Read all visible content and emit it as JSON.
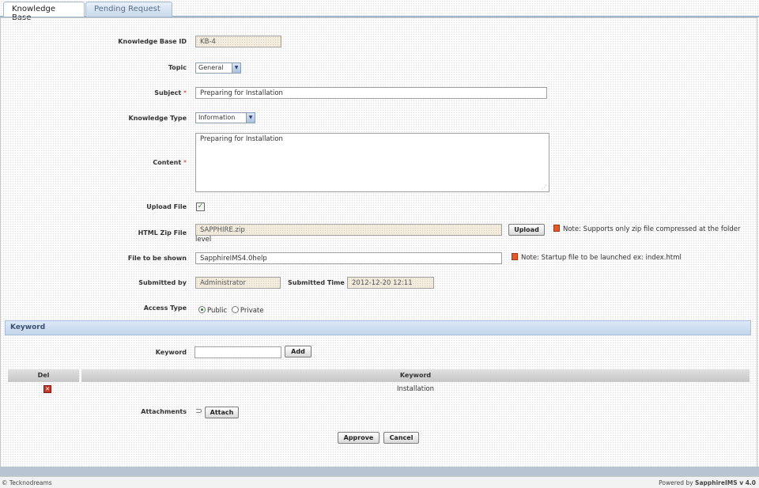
{
  "tabs": [
    {
      "label": "Knowledge Base",
      "active": true
    },
    {
      "label": "Pending Request",
      "active": false
    }
  ],
  "form": {
    "kb_id": {
      "label": "Knowledge Base ID",
      "value": "KB-4"
    },
    "topic": {
      "label": "Topic",
      "value": "General"
    },
    "subject": {
      "label": "Subject",
      "required": "*",
      "value": "Preparing for Installation"
    },
    "knowledge_type": {
      "label": "Knowledge Type",
      "value": "Information"
    },
    "content": {
      "label": "Content",
      "required": "*",
      "value": "Preparing for Installation"
    },
    "upload_file": {
      "label": "Upload File",
      "checked": true
    },
    "html_zip": {
      "label": "HTML Zip File",
      "value": "SAPPHIRE.zip",
      "button": "Upload",
      "note": "Note: Supports only zip file compressed at the folder",
      "note_cont": "level"
    },
    "file_shown": {
      "label": "File to be shown",
      "value": "SapphireIMS4.0help",
      "note": "Note: Startup file to be launched ex: index.html"
    },
    "submitted_by": {
      "label": "Submitted by",
      "value": "Administrator"
    },
    "submitted_time": {
      "label": "Submitted Time",
      "value": "2012-12-20 12:11"
    },
    "access_type": {
      "label": "Access Type",
      "options": [
        "Public",
        "Private"
      ],
      "selected": "Public"
    }
  },
  "keyword_section": {
    "title": "Keyword",
    "input_label": "Keyword",
    "input_value": "",
    "add_button": "Add",
    "table": {
      "columns": [
        "Del",
        "Keyword"
      ],
      "rows": [
        {
          "keyword": "Installation"
        }
      ]
    }
  },
  "attachments": {
    "label": "Attachments",
    "button": "Attach"
  },
  "actions": {
    "approve": "Approve",
    "cancel": "Cancel"
  },
  "footer": {
    "copyright": "© Tecknodreams",
    "powered_prefix": "Powered by",
    "powered_brand": "SapphireIMS v 4.0"
  },
  "colors": {
    "accent": "#9fb6cf",
    "section_bg": "#c4d6ec",
    "delete_icon": "#c0392b",
    "checkbox_check": "#2d7a2d"
  }
}
